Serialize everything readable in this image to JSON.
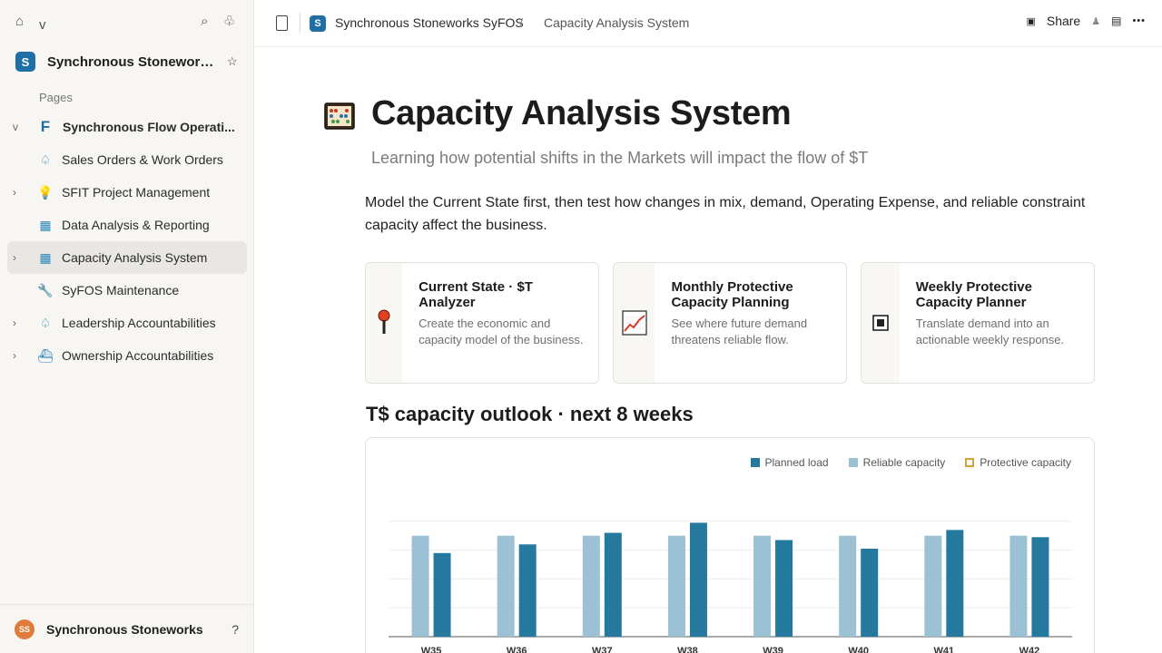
{
  "sidebar": {
    "top": {
      "home_icon": "home-icon",
      "chevron": "v"
    },
    "workspace": {
      "logo_letter": "S",
      "name": "Synchronous Stoneworks..."
    },
    "pages_label": "Pages",
    "items": [
      {
        "label": "Synchronous Flow Operati...",
        "chevron": "v",
        "icon": "F"
      },
      {
        "label": "Sales Orders & Work Orders",
        "chevron": "",
        "icon": "♤"
      },
      {
        "label": "SFIT Project Management",
        "chevron": "›",
        "icon": "💡"
      },
      {
        "label": "Data Analysis & Reporting",
        "chevron": "",
        "icon": "▦"
      },
      {
        "label": "Capacity Analysis System",
        "chevron": "›",
        "icon": "▦"
      },
      {
        "label": "SyFOS Maintenance",
        "chevron": "",
        "icon": "🔧"
      },
      {
        "label": "Leadership Accountabilities",
        "chevron": "›",
        "icon": "♤"
      },
      {
        "label": "Ownership Accountabilities",
        "chevron": "›",
        "icon": "⛴"
      }
    ],
    "footer": {
      "initials": "SS",
      "name": "Synchronous Stoneworks",
      "help": "?"
    }
  },
  "topbar": {
    "logo_letter": "S",
    "breadcrumb_workspace": "Synchronous Stoneworks SyFOS",
    "breadcrumb_sep": "/",
    "breadcrumb_page": "Capacity Analysis System",
    "share_label": "Share",
    "more": "•••"
  },
  "page": {
    "title": "Capacity Analysis System",
    "subtitle": "Learning how potential shifts in the Markets will impact the flow of $T",
    "intro": "Model the Current State first, then test how changes in mix, demand, Operating Expense, and reliable constraint capacity affect the business.",
    "section_title": "T$ capacity outlook · next 8 weeks"
  },
  "cards": [
    {
      "title": "Current State · $T Analyzer",
      "desc": "Create the economic and capacity model of the business.",
      "icon": "pin-icon"
    },
    {
      "title": "Monthly Protective Capacity Planning",
      "desc": "See where future demand threatens reliable flow.",
      "icon": "chart-up-icon"
    },
    {
      "title": "Weekly Protective Capacity Planner",
      "desc": "Translate demand into an actionable weekly response.",
      "icon": "square-target-icon"
    }
  ],
  "colors": {
    "planned": "#25799f",
    "reliable": "#9cc1d5",
    "protective": "#d9a13c"
  },
  "chart_data": {
    "type": "bar",
    "categories": [
      "W35",
      "W36",
      "W37",
      "W38",
      "W39",
      "W40",
      "W41",
      "W42"
    ],
    "series": [
      {
        "name": "Reliable capacity",
        "values": [
          70,
          70,
          70,
          70,
          70,
          70,
          70,
          70
        ]
      },
      {
        "name": "Planned load",
        "values": [
          58,
          64,
          72,
          79,
          67,
          61,
          74,
          69
        ]
      },
      {
        "name": "Protective capacity",
        "values": []
      }
    ],
    "ylim": [
      0,
      100
    ],
    "grid": true,
    "legend": "top-right"
  }
}
